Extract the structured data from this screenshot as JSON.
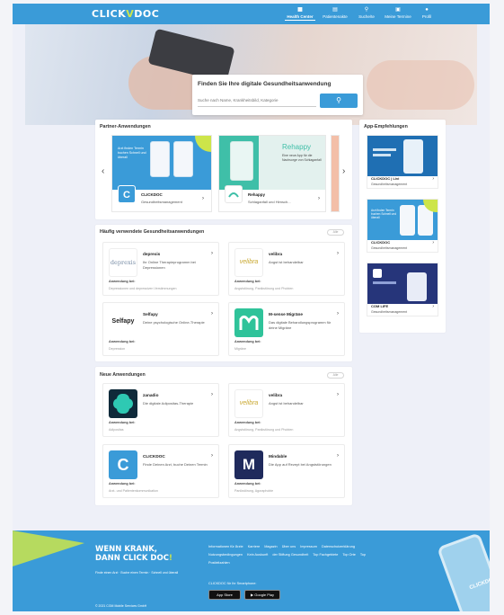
{
  "header": {
    "logo_left": "CLICK",
    "logo_mark": "V",
    "logo_right": "DOC",
    "nav": [
      {
        "label": "Health Center",
        "icon": "▦"
      },
      {
        "label": "Patientenakte",
        "icon": "▤"
      },
      {
        "label": "Suche/te",
        "icon": "⚲"
      },
      {
        "label": "Meine Termine",
        "icon": "▣"
      },
      {
        "label": "Profil",
        "icon": "●"
      }
    ]
  },
  "hero": {
    "title": "Finden Sie Ihre digitale Gesundheitsanwendung",
    "placeholder": "Suche nach Name, Krankheitsbild, Kategorie",
    "search_icon": "⚲"
  },
  "partner": {
    "title": "Partner-Anwendungen",
    "cards": [
      {
        "name": "CLICKDOC",
        "sub": "Gesundheitsmanagement",
        "art_text": "Arzt finden Termin buchen Schnell und überall"
      },
      {
        "name": "Rehappy",
        "sub": "Schlaganfall und Hirnsch...",
        "art_title": "Rehappy",
        "art_text": "Eine neue App für die Nachsorge von Schlaganfall"
      }
    ]
  },
  "frequent": {
    "title": "Häufig verwendete Gesundheitsanwendungen",
    "all_label": "Alle",
    "apps": [
      {
        "name": "deprexis",
        "logo": "deprexis",
        "desc": "Ihr Online Therapieprogramm bei Depressionen",
        "usage_label": "Anwendung bei:",
        "usage": "Depressionen und depressiven Verstimmungen"
      },
      {
        "name": "velibra",
        "logo": "velibra",
        "desc": "Angst ist behandelbar",
        "usage_label": "Anwendung bei:",
        "usage": "Angststörung, Panikstörung und Phobien"
      },
      {
        "name": "Selfapy",
        "logo": "Selfapy",
        "desc": "Deine psychologische Online-Therapie",
        "usage_label": "Anwendung bei:",
        "usage": "Depression"
      },
      {
        "name": "M-sense Migräne",
        "logo": "M",
        "desc": "Das digitale Behandlungsprogramm für deine Migräne",
        "usage_label": "Anwendung bei:",
        "usage": "Migräne"
      }
    ]
  },
  "new_apps": {
    "title": "Neue Anwendungen",
    "all_label": "Alle",
    "apps": [
      {
        "name": "zanadio",
        "desc": "Die digitale Adipositas-Therapie",
        "usage_label": "Anwendung bei:",
        "usage": "Adipositas"
      },
      {
        "name": "velibra",
        "logo": "velibra",
        "desc": "Angst ist behandelbar",
        "usage_label": "Anwendung bei:",
        "usage": "Angststörung, Panikstörung und Phobien"
      },
      {
        "name": "CLICKDOC",
        "logo": "C",
        "desc": "Finde Deinen Arzt, buche Deinen Termin",
        "usage_label": "Anwendung bei:",
        "usage": "Arzt- und Patientenkommunikation"
      },
      {
        "name": "Mindable",
        "logo": "M",
        "desc": "Die App auf Rezept bei Angststörungen",
        "usage_label": "Anwendung bei:",
        "usage": "Panikstörung, Agoraphobie"
      }
    ]
  },
  "recommendations": {
    "title": "App-Empfehlungen",
    "items": [
      {
        "name": "CLICKDOC | Livi",
        "sub": "Gesundheitsmanagement"
      },
      {
        "name": "CLICKDOC",
        "sub": "Gesundheitsmanagement",
        "art_text": "Arzt finden Termin buchen Schnell und überall"
      },
      {
        "name": "COM LIFE",
        "sub": "Gesundheitsmanagement"
      }
    ]
  },
  "footer": {
    "slogan_line1": "WENN KRANK,",
    "slogan_line2_a": "DANN CLICK DOC",
    "slogan_line2_b": "!",
    "subline": "Finde einen Arzt · Buche einen Termin · Schnell und überall",
    "links": [
      "Informationen für Ärzte",
      "Karriere",
      "Magazin",
      "Über uns",
      "Impressum",
      "Datenschutzerklärung",
      "Nutzungsbedingungen",
      "Kein Auskunft",
      "der Stiftung Gesundheit",
      "Top Fachgebiete",
      "Top Orte",
      "Top Postleitzahlen"
    ],
    "apps_title": "CLICKDOC für Ihr Smartphone:",
    "appstore": "App Store",
    "googleplay": "Google Play",
    "copyright": "© 2021 CGM Mobile Services GmbH",
    "phone_text": "CLICKDOC"
  },
  "colors": {
    "primary": "#3a9bd8",
    "accent": "#cde54a"
  }
}
